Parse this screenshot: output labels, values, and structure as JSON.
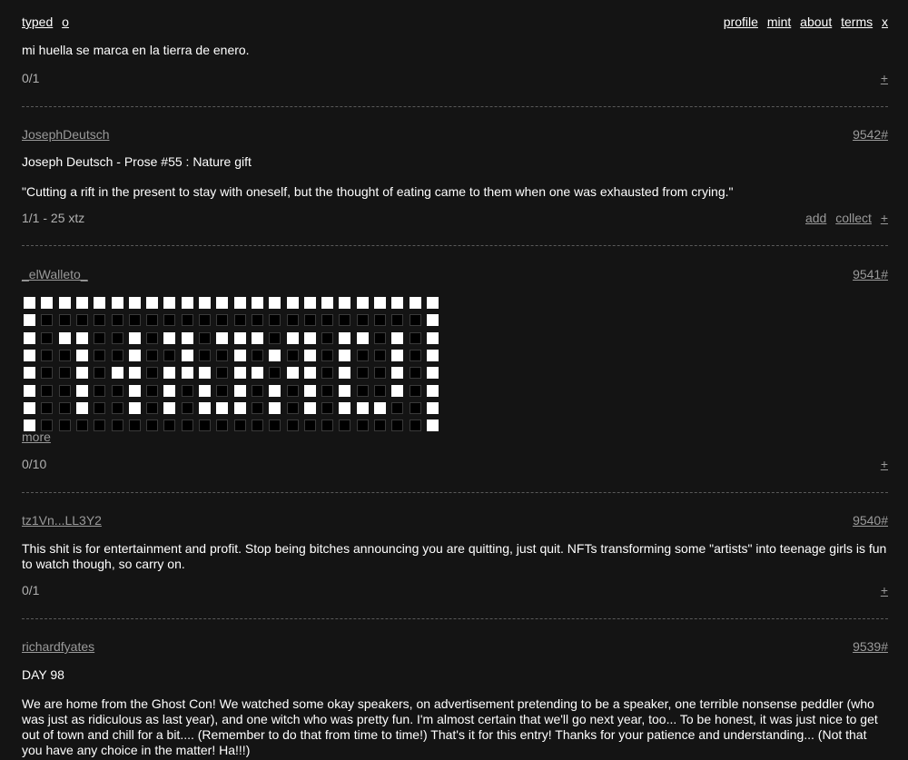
{
  "nav": {
    "left": [
      "typed",
      "o"
    ],
    "right": [
      "profile",
      "mint",
      "about",
      "terms",
      "x"
    ]
  },
  "posts": [
    {
      "partial_text": "mi huella se marca en la tierra de enero.",
      "meta": "0/1",
      "plus": "+"
    },
    {
      "author": "JosephDeutsch",
      "number": "9542#",
      "title": "Joseph Deutsch - Prose #55 : Nature gift",
      "text": "\"Cutting a rift in the present to stay with oneself, but the thought of eating came to them when one was exhausted from crying.\"",
      "meta": "1/1 - 25 xtz",
      "add": "add",
      "collect": "collect",
      "plus": "+"
    },
    {
      "author": "_elWalleto_",
      "number": "9541#",
      "grid": [
        "111111111111111111111111",
        "100000000000000000000001",
        "101100101101110110110101",
        "100100100100101010100101",
        "100101101110110110100101",
        "100100101010101010100101",
        "100100101011101010111001",
        "100000000000000000000001"
      ],
      "ellipsis": "...",
      "more": "more",
      "meta": "0/10",
      "plus": "+"
    },
    {
      "author": "tz1Vn...LL3Y2",
      "number": "9540#",
      "text": "This shit is for entertainment and profit. Stop being bitches announcing you are quitting, just quit. NFTs transforming some \"artists\" into teenage girls is fun to watch though, so carry on.",
      "meta": "0/1",
      "plus": "+"
    },
    {
      "author": "richardfyates",
      "number": "9539#",
      "title": "DAY 98",
      "text": "We are home from the Ghost Con! We watched some okay speakers, on advertisement pretending to be a speaker, one terrible nonsense peddler (who was just as ridiculous as last year), and one witch who was pretty fun. I'm almost certain that we'll go next year, too... To be honest, it was just nice to get out of town and chill for a bit.... (Remember to do that from time to time!) That's it for this entry! Thanks for your patience and understanding... (Not that you have any choice in the matter! Ha!!!)"
    }
  ]
}
